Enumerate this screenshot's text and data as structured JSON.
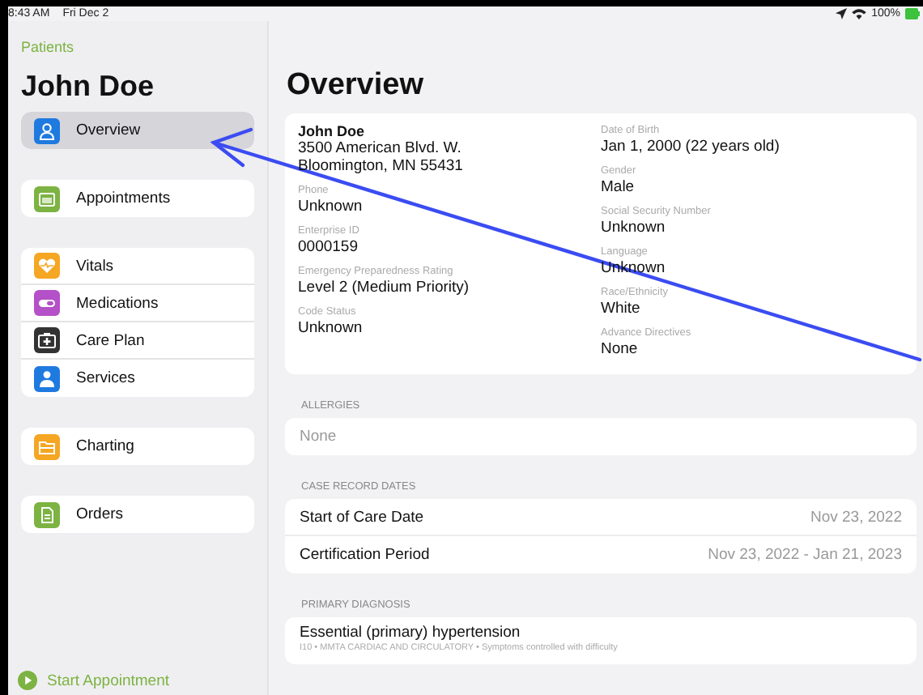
{
  "status_bar": {
    "time": "8:43 AM",
    "date": "Fri Dec 2",
    "battery": "100%"
  },
  "sidebar": {
    "back_link": "Patients",
    "patient_name": "John Doe",
    "groups": [
      {
        "items": [
          {
            "label": "Overview",
            "kind": "person",
            "color": "#1f7ae0",
            "selected": true
          }
        ]
      },
      {
        "items": [
          {
            "label": "Appointments",
            "kind": "calendar",
            "color": "#7cb342",
            "selected": false
          }
        ]
      },
      {
        "items": [
          {
            "label": "Vitals",
            "kind": "heart",
            "color": "#f5a623",
            "selected": false
          },
          {
            "label": "Medications",
            "kind": "pill",
            "color": "#b450c8",
            "selected": false
          },
          {
            "label": "Care Plan",
            "kind": "kit",
            "color": "#333333",
            "selected": false
          },
          {
            "label": "Services",
            "kind": "people",
            "color": "#1f7ae0",
            "selected": false
          }
        ]
      },
      {
        "items": [
          {
            "label": "Charting",
            "kind": "folder",
            "color": "#f5a623",
            "selected": false
          }
        ]
      },
      {
        "items": [
          {
            "label": "Orders",
            "kind": "document",
            "color": "#7cb342",
            "selected": false
          }
        ]
      }
    ],
    "start_button": "Start Appointment"
  },
  "main": {
    "title": "Overview",
    "details": {
      "name": "John Doe",
      "address_lines": [
        "3500 American Blvd. W.",
        "Bloomington, MN 55431"
      ],
      "left_fields": [
        {
          "label": "Phone",
          "value": "Unknown"
        },
        {
          "label": "Enterprise ID",
          "value": "0000159"
        },
        {
          "label": "Emergency Preparedness Rating",
          "value": "Level 2 (Medium Priority)"
        },
        {
          "label": "Code Status",
          "value": "Unknown"
        }
      ],
      "right_fields": [
        {
          "label": "Date of Birth",
          "value": "Jan 1, 2000 (22 years old)"
        },
        {
          "label": "Gender",
          "value": "Male"
        },
        {
          "label": "Social Security Number",
          "value": "Unknown"
        },
        {
          "label": "Language",
          "value": "Unknown"
        },
        {
          "label": "Race/Ethnicity",
          "value": "White"
        },
        {
          "label": "Advance Directives",
          "value": "None"
        }
      ]
    },
    "sections": [
      {
        "heading": "ALLERGIES",
        "kind": "empty",
        "text": "None"
      },
      {
        "heading": "CASE RECORD DATES",
        "kind": "rows",
        "rows": [
          {
            "label": "Start of Care Date",
            "value": "Nov 23, 2022"
          },
          {
            "label": "Certification Period",
            "value": "Nov 23, 2022 - Jan 21, 2023"
          }
        ]
      },
      {
        "heading": "PRIMARY DIAGNOSIS",
        "kind": "diagnosis",
        "title": "Essential (primary) hypertension",
        "detail": "I10 • MMTA CARDIAC AND CIRCULATORY • Symptoms controlled with difficulty"
      }
    ]
  }
}
